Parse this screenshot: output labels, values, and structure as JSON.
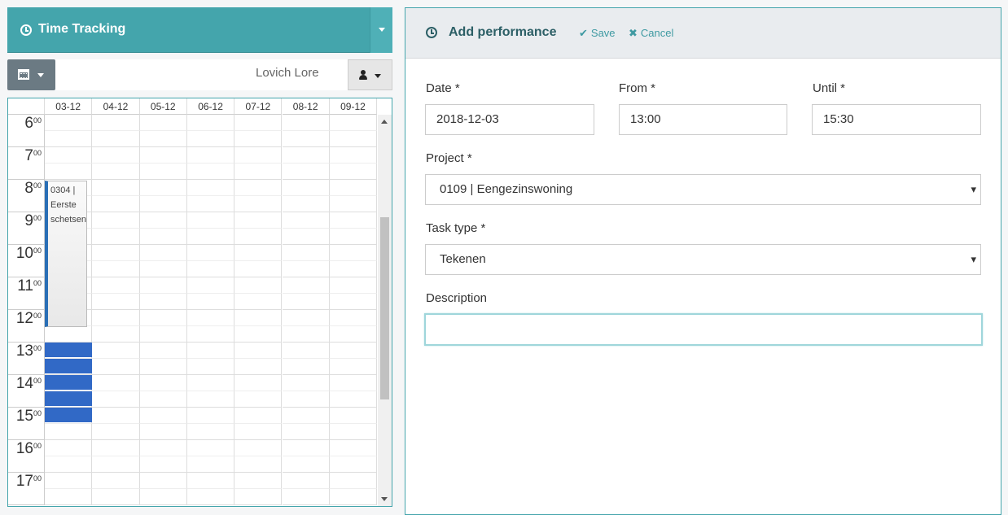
{
  "left": {
    "title": "Time Tracking",
    "user_name": "Lovich Lore",
    "days": [
      "03-12",
      "04-12",
      "05-12",
      "06-12",
      "07-12",
      "08-12",
      "09-12"
    ],
    "hours": [
      "6",
      "7",
      "8",
      "9",
      "10",
      "11",
      "12",
      "13",
      "14",
      "15",
      "16",
      "17"
    ],
    "minute_suffix": "00",
    "event": {
      "line1": "0304 |",
      "line2": "Eerste",
      "line3": "schetsen"
    }
  },
  "form": {
    "title": "Add performance",
    "save_label": "Save",
    "cancel_label": "Cancel",
    "date_label": "Date *",
    "date_value": "2018-12-03",
    "from_label": "From *",
    "from_value": "13:00",
    "until_label": "Until *",
    "until_value": "15:30",
    "project_label": "Project *",
    "project_value": "0109 | Eengezinswoning",
    "task_label": "Task type *",
    "task_value": "Tekenen",
    "description_label": "Description",
    "description_value": ""
  },
  "colors": {
    "accent": "#44a5ac",
    "selection": "#3169c6",
    "event_border": "#2a6fb6"
  }
}
